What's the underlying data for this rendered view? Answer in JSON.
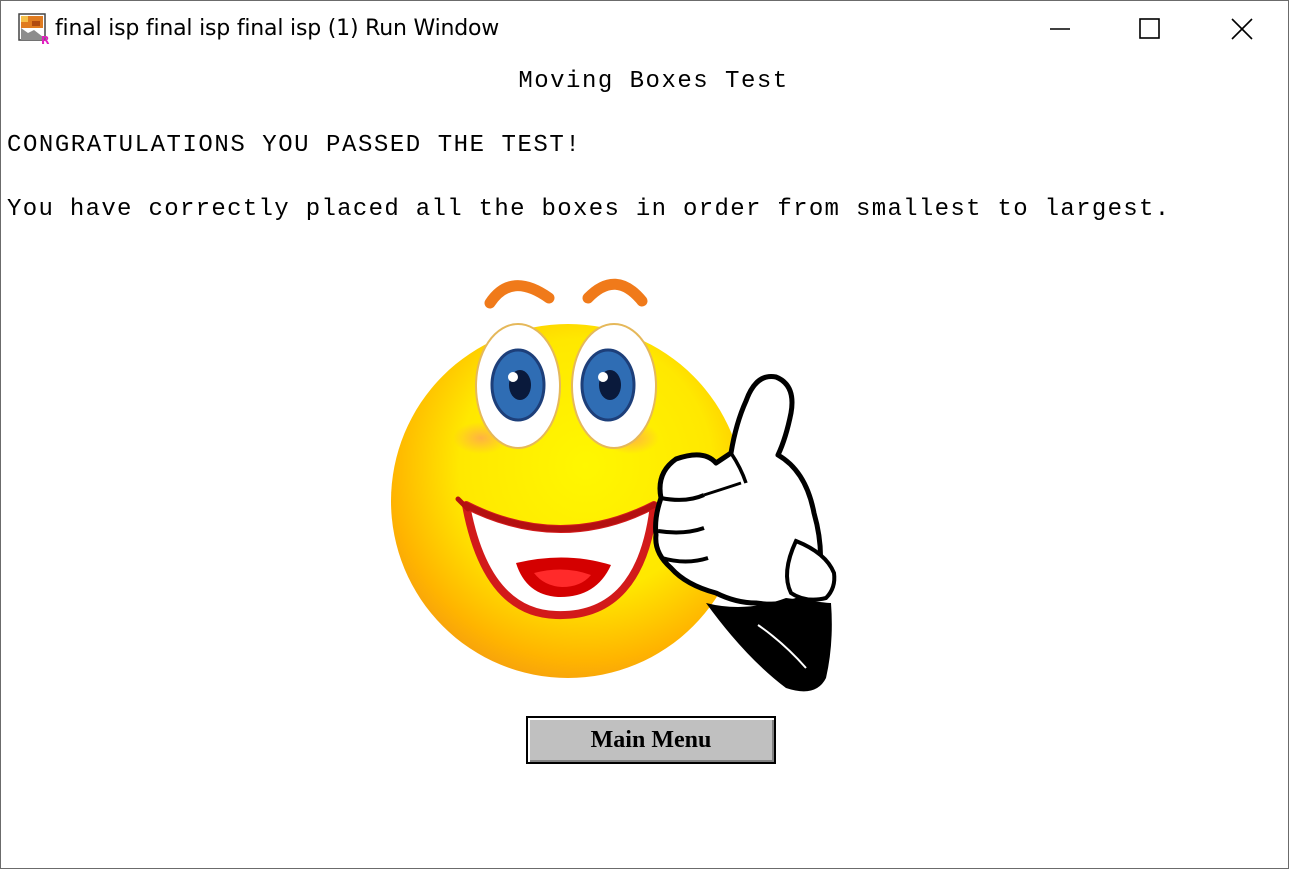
{
  "window": {
    "title": "final isp final isp final isp (1) Run Window",
    "app_icon": "ready-to-program-icon",
    "controls": {
      "minimize_icon": "minimize-icon",
      "maximize_icon": "maximize-icon",
      "close_icon": "close-icon"
    }
  },
  "content": {
    "heading": "Moving Boxes Test",
    "message_line1": "CONGRATULATIONS YOU PASSED THE TEST!",
    "message_line2": "You have correctly placed all the boxes in order from smallest to largest.",
    "image": "smiley-thumbs-up-icon",
    "main_menu_button": "Main Menu"
  },
  "colors": {
    "face_yellow": "#ffe800",
    "face_orange": "#f39a12",
    "iris_blue": "#2f6db4",
    "button_gray": "#c0c0c0"
  }
}
